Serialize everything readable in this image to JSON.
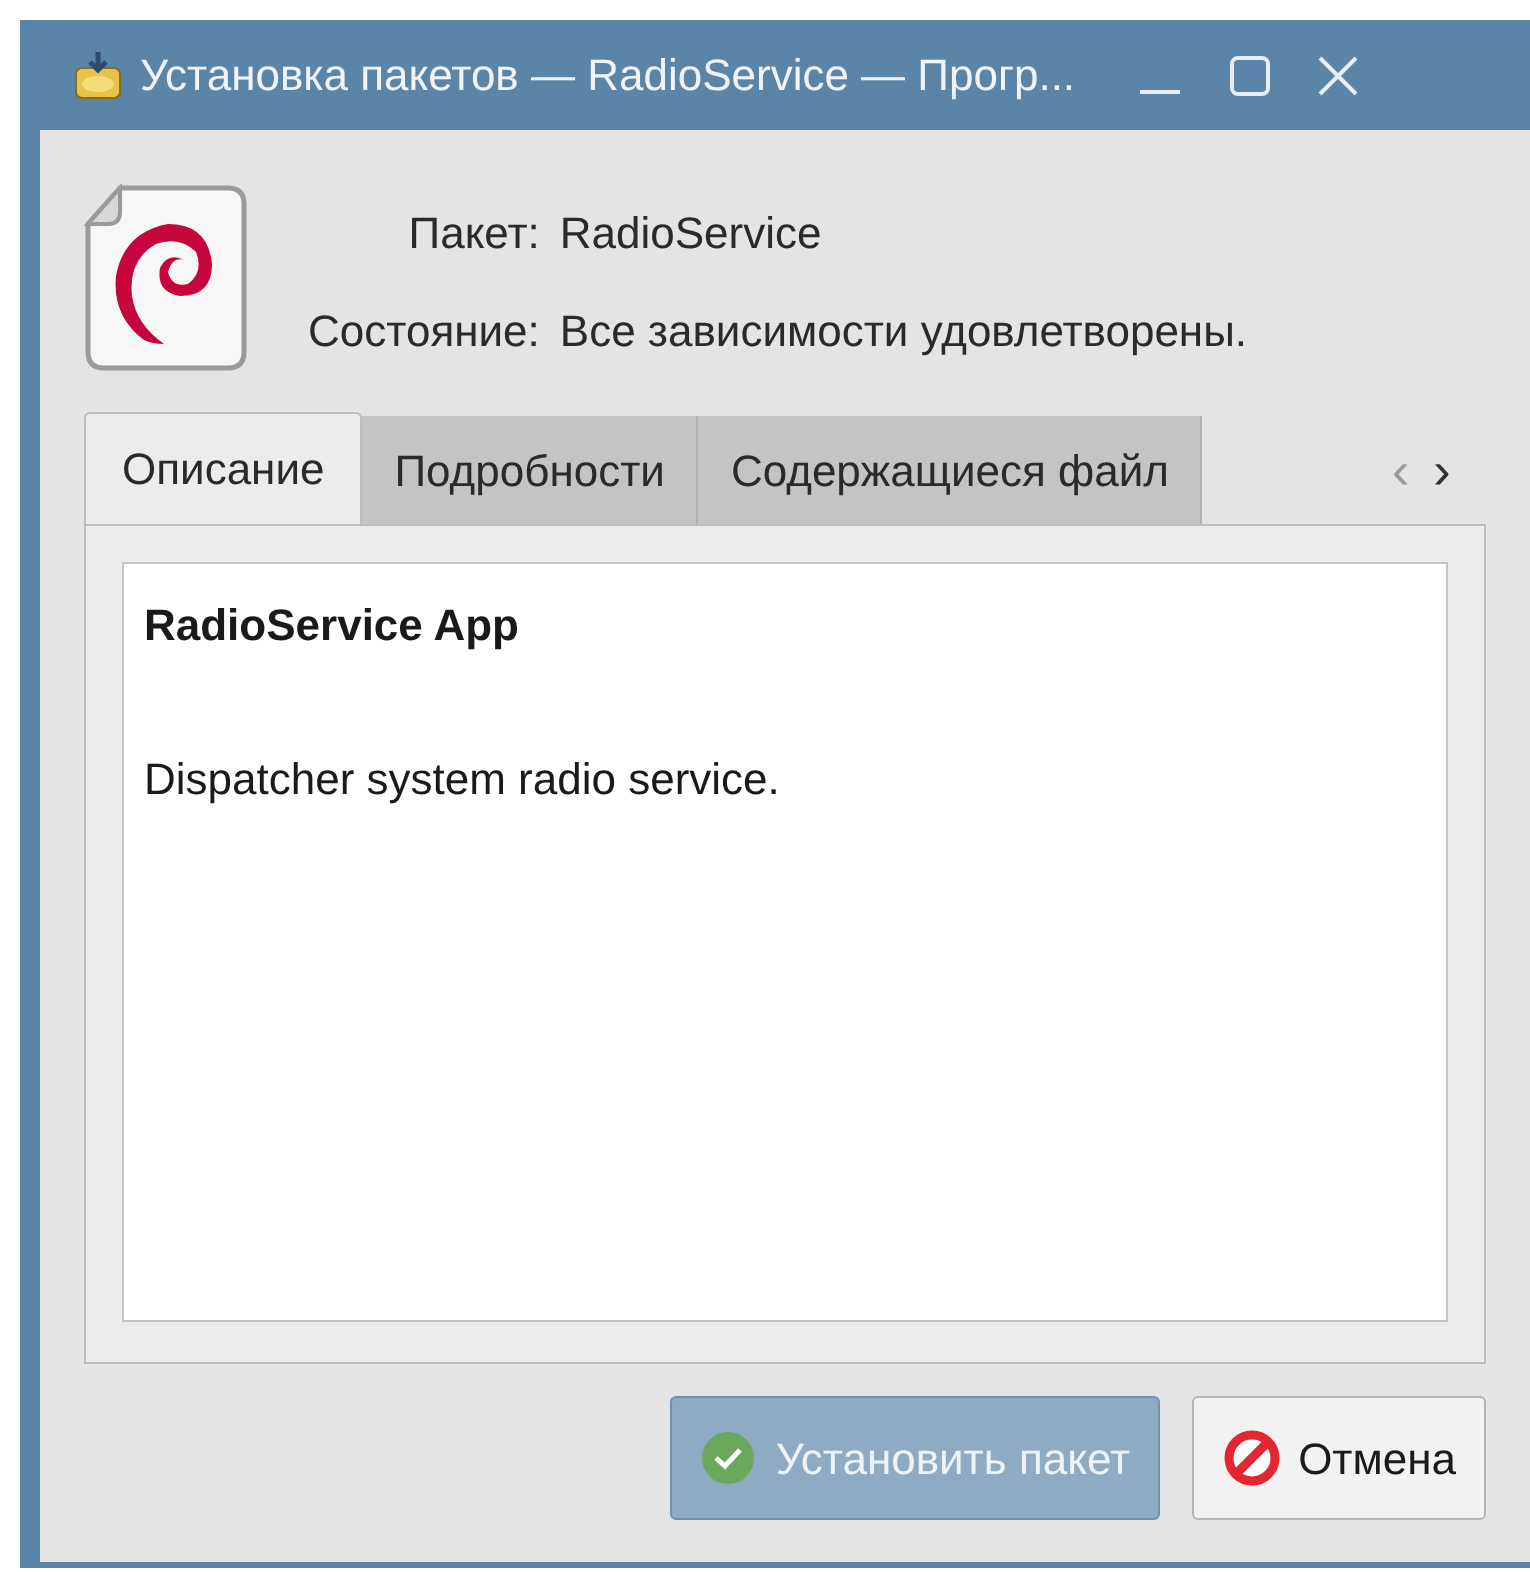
{
  "window": {
    "title": "Установка пакетов — RadioService — Прогр..."
  },
  "info": [
    {
      "label": "Пакет:",
      "value": "RadioService"
    },
    {
      "label": "Состояние:",
      "value": "Все зависимости удовлетворены."
    }
  ],
  "tabs": [
    {
      "label": "Описание",
      "selected": true
    },
    {
      "label": "Подробности",
      "selected": false
    },
    {
      "label": "Содержащиеся файл",
      "selected": false
    }
  ],
  "tab_scroll": [
    "‹",
    "›"
  ],
  "description": {
    "title": "RadioService App",
    "body": "Dispatcher system radio service."
  },
  "buttons": [
    {
      "label": "Установить пакет",
      "kind": "install",
      "default": true
    },
    {
      "label": "Отмена",
      "kind": "cancel",
      "default": false
    }
  ]
}
